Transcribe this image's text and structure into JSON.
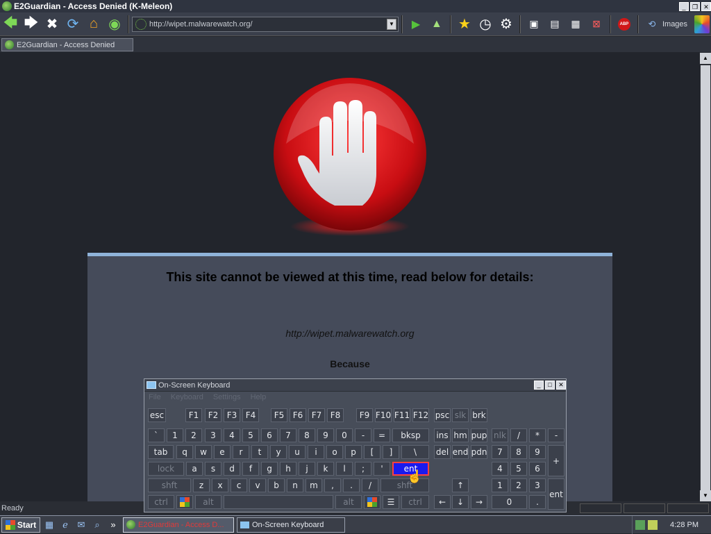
{
  "window": {
    "title": "E2Guardian - Access Denied (K-Meleon)"
  },
  "toolbar": {
    "url": "http://wipet.malwarewatch.org/",
    "images_label": "Images"
  },
  "tabs": [
    {
      "label": "E2Guardian - Access Denied"
    }
  ],
  "page": {
    "headline": "This site cannot be viewed at this time, read below for details:",
    "blocked_url": "http://wipet.malwarewatch.org",
    "because_label": "Because"
  },
  "status": {
    "text": "Ready"
  },
  "taskbar": {
    "start_label": "Start",
    "tasks": [
      {
        "label": "E2Guardian - Access D..."
      },
      {
        "label": "On-Screen Keyboard"
      }
    ],
    "clock": "4:28 PM"
  },
  "osk": {
    "title": "On-Screen Keyboard",
    "menu": [
      "File",
      "Keyboard",
      "Settings",
      "Help"
    ],
    "keys": {
      "esc": "esc",
      "f1": "F1",
      "f2": "F2",
      "f3": "F3",
      "f4": "F4",
      "f5": "F5",
      "f6": "F6",
      "f7": "F7",
      "f8": "F8",
      "f9": "F9",
      "f10": "F10",
      "f11": "F11",
      "f12": "F12",
      "psc": "psc",
      "slk": "slk",
      "brk": "brk",
      "backtick": "`",
      "k1": "1",
      "k2": "2",
      "k3": "3",
      "k4": "4",
      "k5": "5",
      "k6": "6",
      "k7": "7",
      "k8": "8",
      "k9": "9",
      "k0": "0",
      "minus": "-",
      "equals": "=",
      "bksp": "bksp",
      "ins": "ins",
      "hm": "hm",
      "pup": "pup",
      "nlk": "nlk",
      "div": "/",
      "mul": "*",
      "sub": "-",
      "tab": "tab",
      "q": "q",
      "w": "w",
      "e": "e",
      "r": "r",
      "t": "t",
      "y": "y",
      "u": "u",
      "i": "i",
      "o": "o",
      "p": "p",
      "lbr": "[",
      "rbr": "]",
      "bslash": "\\",
      "del": "del",
      "end": "end",
      "pdn": "pdn",
      "n7": "7",
      "n8": "8",
      "n9": "9",
      "plus": "+",
      "lock": "lock",
      "a": "a",
      "s": "s",
      "d": "d",
      "f": "f",
      "g": "g",
      "h": "h",
      "j": "j",
      "k": "k",
      "l": "l",
      "semi": ";",
      "quote": "'",
      "ent": "ent",
      "n4": "4",
      "n5": "5",
      "n6": "6",
      "shft": "shft",
      "z": "z",
      "x": "x",
      "c": "c",
      "v": "v",
      "b": "b",
      "n": "n",
      "m": "m",
      "comma": ",",
      "period": ".",
      "slash": "/",
      "rshft": "shft",
      "n1": "1",
      "n2": "2",
      "n3": "3",
      "nent": "ent",
      "ctrl": "ctrl",
      "alt": "alt",
      "ralt": "alt",
      "rctrl": "ctrl",
      "n0": "0",
      "ndot": "."
    }
  },
  "colors": {
    "stop_red": "#e0141a",
    "panel_top": "#8fb3d9",
    "enter_key": "#1a1aee"
  }
}
